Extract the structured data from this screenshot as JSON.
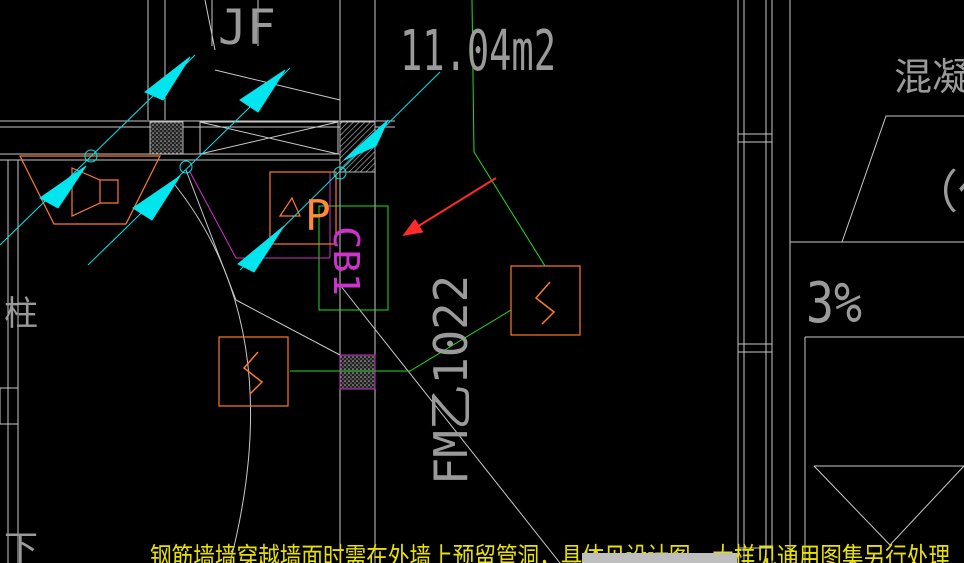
{
  "labels": {
    "area": "11.04m2",
    "slope": "3%",
    "door_code": "FM乙1022",
    "tag_cb": "CB1",
    "tag_p": "P",
    "concrete_top": "混凝土面",
    "paren_text": "（仅",
    "jf": "JF",
    "left_char_1": "柱",
    "left_char_2": "下",
    "bottom_note": "钢筋墙墙穿越墙面时需在外墙上预留管洞，具体见设计图，大样见通用图集另行处理"
  },
  "colors": {
    "background": "#000000",
    "linework": "#c8c8c8",
    "cyan": "#00e5ee",
    "orange": "#ff7a2a",
    "green": "#22dd22",
    "magenta": "#cc33cc",
    "red_arrow": "#ff2a2a",
    "yellow_note": "#e8e000"
  }
}
